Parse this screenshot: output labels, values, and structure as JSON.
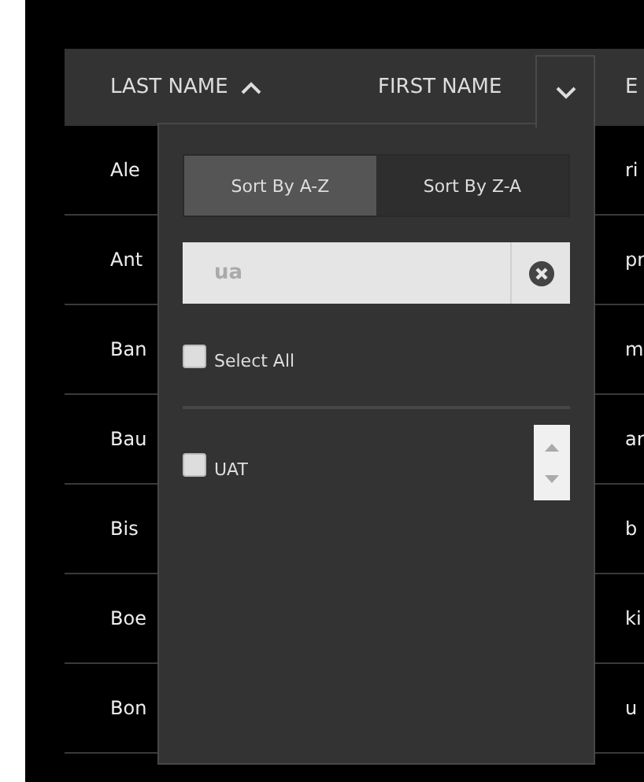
{
  "columns": [
    {
      "label": "LAST NAME",
      "sorted_ascending": true
    },
    {
      "label": "FIRST NAME",
      "menu_open": true
    },
    {
      "label": "E"
    }
  ],
  "rows": [
    {
      "last_name": "Ale",
      "column_3": "ri"
    },
    {
      "last_name": "Ant",
      "column_3": "pr"
    },
    {
      "last_name": "Ban",
      "column_3": "m"
    },
    {
      "last_name": "Bau",
      "column_3": "ar"
    },
    {
      "last_name": "Bis",
      "column_3": "b"
    },
    {
      "last_name": "Boe",
      "column_3": "ki"
    },
    {
      "last_name": "Bon",
      "column_3": "u"
    }
  ],
  "filter_menu": {
    "sort_buttons": [
      {
        "label": "Sort By A-Z",
        "selected": true
      },
      {
        "label": "Sort By Z-A",
        "selected": false
      }
    ],
    "search": {
      "value": "ua"
    },
    "select_all": {
      "label": "Select All",
      "checked": false
    },
    "options": [
      {
        "label": "UAT",
        "checked": false
      }
    ]
  }
}
